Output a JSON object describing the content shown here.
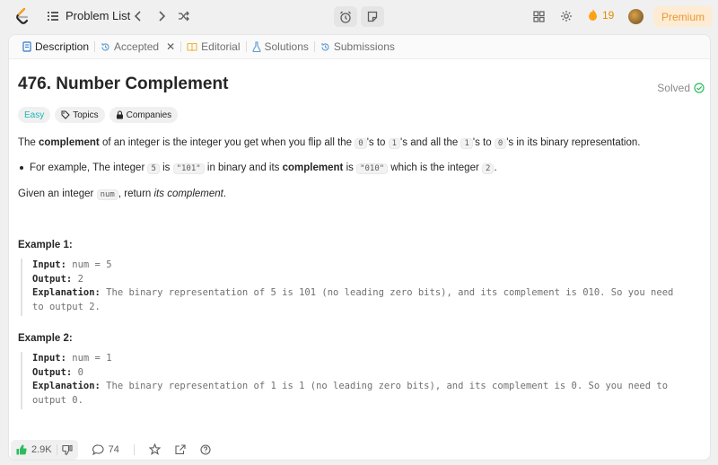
{
  "topbar": {
    "problem_list_label": "Problem List",
    "streak_count": "19",
    "premium_label": "Premium"
  },
  "tabs": [
    {
      "label": "Description",
      "icon": "description-icon"
    },
    {
      "label": "Accepted",
      "icon": "history-icon"
    },
    {
      "label": "Editorial",
      "icon": "book-icon"
    },
    {
      "label": "Solutions",
      "icon": "flask-icon"
    },
    {
      "label": "Submissions",
      "icon": "history-icon"
    }
  ],
  "problem": {
    "title": "476. Number Complement",
    "status": "Solved",
    "tags": [
      "Easy",
      "Topics",
      "Companies"
    ],
    "p1": {
      "t1": "The ",
      "b1": "complement",
      "t2": " of an integer is the integer you get when you flip all the ",
      "c1": "0",
      "t3": "'s to ",
      "c2": "1",
      "t4": "'s and all the ",
      "c3": "1",
      "t5": "'s to ",
      "c4": "0",
      "t6": "'s in its binary representation."
    },
    "bullet": {
      "t1": "For example, The integer ",
      "c1": "5",
      "t2": " is ",
      "c2": "\"101\"",
      "t3": " in binary and its ",
      "b1": "complement",
      "t4": " is ",
      "c3": "\"010\"",
      "t5": " which is the integer ",
      "c4": "2",
      "t6": "."
    },
    "p2": {
      "t1": "Given an integer ",
      "c1": "num",
      "t2": ", return ",
      "i1": "its complement",
      "t3": "."
    },
    "examples": [
      {
        "title": "Example 1:",
        "input_label": "Input:",
        "input": " num = 5",
        "output_label": "Output:",
        "output": " 2",
        "explanation_label": "Explanation:",
        "explanation_l1": " The binary representation of 5 is 101 (no leading zero bits), and its complement is 010. So you need",
        "explanation_l2": "to output 2."
      },
      {
        "title": "Example 2:",
        "input_label": "Input:",
        "input": " num = 1",
        "output_label": "Output:",
        "output": " 0",
        "explanation_label": "Explanation:",
        "explanation_l1": " The binary representation of 1 is 1 (no leading zero bits), and its complement is 0. So you need to",
        "explanation_l2": "output 0."
      }
    ]
  },
  "bottombar": {
    "likes": "2.9K",
    "comments": "74"
  },
  "colors": {
    "accent_orange": "#ffa116",
    "easy_teal": "#1cb8b8",
    "solved_green": "#2cbb5d",
    "like_green": "#2cbb5d"
  }
}
